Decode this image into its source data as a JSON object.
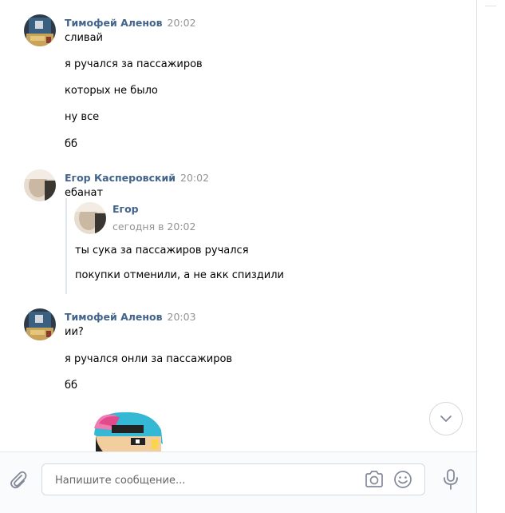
{
  "messages": [
    {
      "author": "Тимофей Аленов",
      "time": "20:02",
      "lines": [
        "сливай",
        "я ручался за пассажиров",
        "которых не было",
        "ну все",
        "бб"
      ]
    },
    {
      "author": "Егор Касперовский",
      "time": "20:02",
      "lines": [
        "ебанат"
      ],
      "forwarded": {
        "author": "Егор",
        "date": "сегодня в 20:02",
        "lines": [
          "ты сука за пассажиров ручался",
          "покупки отменили, а не акк спиздили"
        ]
      }
    },
    {
      "author": "Тимофей Аленов",
      "time": "20:03",
      "lines": [
        "ии?",
        "я ручался онли за пассажиров",
        "бб"
      ]
    }
  ],
  "composer": {
    "placeholder": "Напишите сообщение..."
  },
  "icons": {
    "attach": "paperclip-icon",
    "camera": "camera-icon",
    "emoji": "smile-icon",
    "mic": "microphone-icon",
    "scroll": "chevron-down-icon"
  },
  "colors": {
    "author": "#42648b",
    "time": "#939393",
    "quote_border": "#dfe6ed",
    "icon": "#828a99"
  }
}
